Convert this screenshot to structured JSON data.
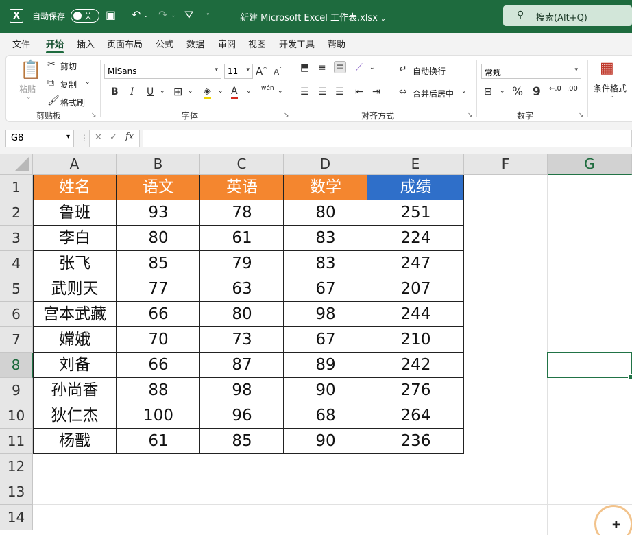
{
  "titlebar": {
    "autosave_label": "自动保存",
    "autosave_state": "关",
    "filename": "新建 Microsoft Excel 工作表.xlsx",
    "title_arrow": "⌄",
    "search_placeholder": "搜索(Alt+Q)",
    "icons": [
      "excel-logo-icon",
      "save-icon",
      "undo-icon",
      "redo-icon",
      "filter-icon",
      "customize-icon",
      "search-icon"
    ]
  },
  "menu": {
    "items": [
      "文件",
      "开始",
      "插入",
      "页面布局",
      "公式",
      "数据",
      "审阅",
      "视图",
      "开发工具",
      "帮助"
    ],
    "active": "开始"
  },
  "ribbon": {
    "clipboard": {
      "paste": "粘贴",
      "cut": "剪切",
      "copy": "复制",
      "format_painter": "格式刷",
      "label": "剪贴板"
    },
    "font": {
      "name": "MiSans",
      "size": "11",
      "bold": "B",
      "italic": "I",
      "underline": "U",
      "grow": "A",
      "shrink": "A",
      "color_a": "A",
      "phonetic": "wén",
      "label": "字体"
    },
    "alignment": {
      "wrap": "自动换行",
      "merge": "合并后居中",
      "label": "对齐方式"
    },
    "number": {
      "format": "常规",
      "percent": "%",
      "comma": "9",
      "inc_decimal": "←.0",
      "dec_decimal": ".00",
      "label": "数字"
    },
    "styles": {
      "cond_format": "条件格式"
    }
  },
  "formula_bar": {
    "name_box": "G8",
    "fx": "fx",
    "formula": ""
  },
  "grid": {
    "columns": [
      "A",
      "B",
      "C",
      "D",
      "E",
      "F",
      "G"
    ],
    "rows": [
      "1",
      "2",
      "3",
      "4",
      "5",
      "6",
      "7",
      "8",
      "9",
      "10",
      "11",
      "12",
      "13",
      "14"
    ],
    "selected_cell": "G8",
    "header": [
      "姓名",
      "语文",
      "英语",
      "数学",
      "成绩"
    ],
    "data": [
      [
        "鲁班",
        "93",
        "78",
        "80",
        "251"
      ],
      [
        "李白",
        "80",
        "61",
        "83",
        "224"
      ],
      [
        "张飞",
        "85",
        "79",
        "83",
        "247"
      ],
      [
        "武则天",
        "77",
        "63",
        "67",
        "207"
      ],
      [
        "宫本武藏",
        "66",
        "80",
        "98",
        "244"
      ],
      [
        "嫦娥",
        "70",
        "73",
        "67",
        "210"
      ],
      [
        "刘备",
        "66",
        "87",
        "89",
        "242"
      ],
      [
        "孙尚香",
        "88",
        "98",
        "90",
        "276"
      ],
      [
        "狄仁杰",
        "100",
        "96",
        "68",
        "264"
      ],
      [
        "杨戬",
        "61",
        "85",
        "90",
        "236"
      ]
    ]
  },
  "colors": {
    "titlebar": "#1e6b3e",
    "header_orange": "#f4862f",
    "header_blue": "#2f6fc9",
    "selection": "#217346"
  }
}
